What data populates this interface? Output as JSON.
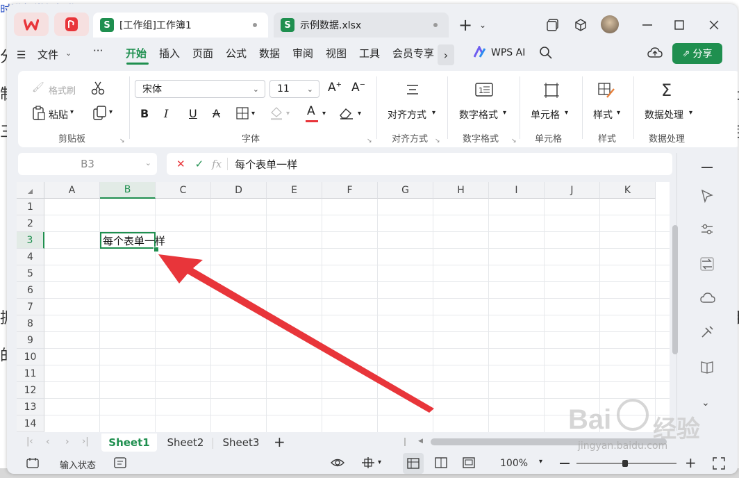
{
  "background": {
    "top_text": "时进行常规操作",
    "left_chars": [
      "分",
      "制",
      "三",
      "据",
      "的"
    ],
    "right_chars": [
      "定",
      "上",
      "月"
    ]
  },
  "titlebar": {
    "tabs": [
      {
        "badge": "S",
        "label": "[工作组]工作簿1"
      },
      {
        "badge": "S",
        "label": "示例数据.xlsx"
      }
    ]
  },
  "menu": {
    "file": "文件",
    "more": "···",
    "items": [
      "开始",
      "插入",
      "页面",
      "公式",
      "数据",
      "审阅",
      "视图",
      "工具",
      "会员专享"
    ],
    "wps_ai": "WPS AI",
    "share": "分享"
  },
  "ribbon": {
    "format_painter": "格式刷",
    "paste": "粘贴",
    "group_clipboard": "剪贴板",
    "font_name": "宋体",
    "font_size": "11",
    "bold": "B",
    "italic": "I",
    "underline": "U",
    "strike": "A",
    "font_color": "A",
    "group_font": "字体",
    "align": "对齐方式",
    "group_align": "对齐方式",
    "number_format": "数字格式",
    "group_number": "数字格式",
    "cell": "单元格",
    "group_cell": "单元格",
    "style": "样式",
    "group_style": "样式",
    "data_process": "数据处理",
    "group_data": "数据处理"
  },
  "formula": {
    "cell_ref": "B3",
    "cancel": "✕",
    "confirm": "✓",
    "fx": "fx",
    "content": "每个表单一样"
  },
  "grid": {
    "columns": [
      "A",
      "B",
      "C",
      "D",
      "E",
      "F",
      "G",
      "H",
      "I",
      "J",
      "K"
    ],
    "rows": [
      "1",
      "2",
      "3",
      "4",
      "5",
      "6",
      "7",
      "8",
      "9",
      "10",
      "11",
      "12",
      "13",
      "14"
    ],
    "selected_cell_text": "每个表单一样"
  },
  "sheets": [
    "Sheet1",
    "Sheet2",
    "Sheet3"
  ],
  "status": {
    "input_state": "输入状态",
    "zoom": "100%"
  },
  "watermark": {
    "brand": "Bai",
    "brand2": "经验",
    "url": "jingyan.baidu.com"
  },
  "colors": {
    "accent": "#1f8f4f",
    "arrow": "#e8353a",
    "wps_red": "#e8353a"
  }
}
